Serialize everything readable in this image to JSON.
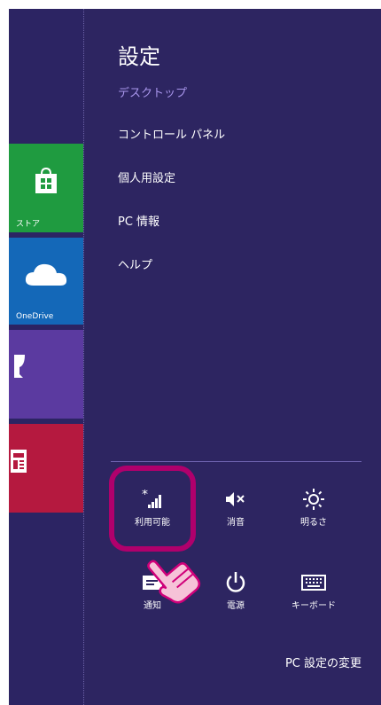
{
  "start_tiles": [
    {
      "label": "ストア",
      "icon": "store-icon"
    },
    {
      "label": "OneDrive",
      "icon": "cloud-icon"
    },
    {
      "label": "",
      "icon": "trophy-icon"
    },
    {
      "label": "",
      "icon": "news-icon"
    }
  ],
  "settings": {
    "title": "設定",
    "subtitle": "デスクトップ",
    "menu": [
      "コントロール パネル",
      "個人用設定",
      "PC 情報",
      "ヘルプ"
    ]
  },
  "quick_settings": [
    {
      "label": "利用可能",
      "icon": "wifi-icon"
    },
    {
      "label": "消音",
      "icon": "mute-icon"
    },
    {
      "label": "明るさ",
      "icon": "brightness-icon"
    },
    {
      "label": "通知",
      "icon": "notifications-icon"
    },
    {
      "label": "電源",
      "icon": "power-icon"
    },
    {
      "label": "キーボード",
      "icon": "keyboard-icon"
    }
  ],
  "footer": {
    "pc_settings_label": "PC 設定の変更"
  },
  "colors": {
    "panel": "#2d2561",
    "highlight": "#b0006c",
    "accent_text": "#a996ec"
  }
}
